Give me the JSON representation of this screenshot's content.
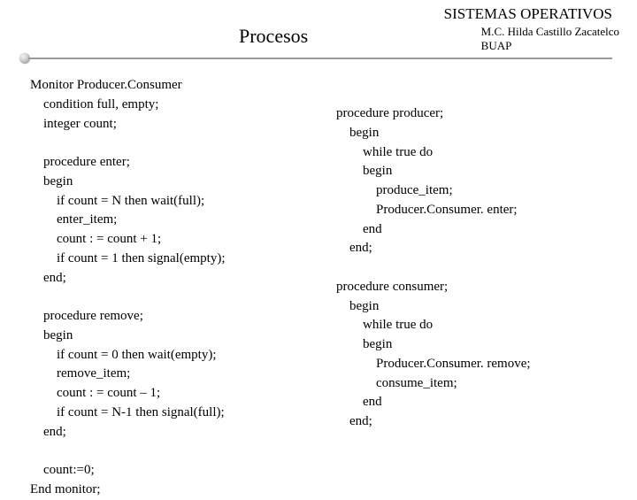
{
  "header": {
    "course": "SISTEMAS OPERATIVOS",
    "section": "Procesos",
    "author_line1": "M.C. Hilda Castillo Zacatelco",
    "author_line2": "BUAP"
  },
  "left_code": "Monitor Producer.Consumer\n    condition full, empty;\n    integer count;\n\n    procedure enter;\n    begin\n        if count = N then wait(full);\n        enter_item;\n        count : = count + 1;\n        if count = 1 then signal(empty);\n    end;\n\n    procedure remove;\n    begin\n        if count = 0 then wait(empty);\n        remove_item;\n        count : = count – 1;\n        if count = N-1 then signal(full);\n    end;\n\n    count:=0;\nEnd monitor;",
  "right_code": "procedure producer;\n    begin\n        while true do\n        begin\n            produce_item;\n            Producer.Consumer. enter;\n        end\n    end;\n\nprocedure consumer;\n    begin\n        while true do\n        begin\n            Producer.Consumer. remove;\n            consume_item;\n        end\n    end;"
}
